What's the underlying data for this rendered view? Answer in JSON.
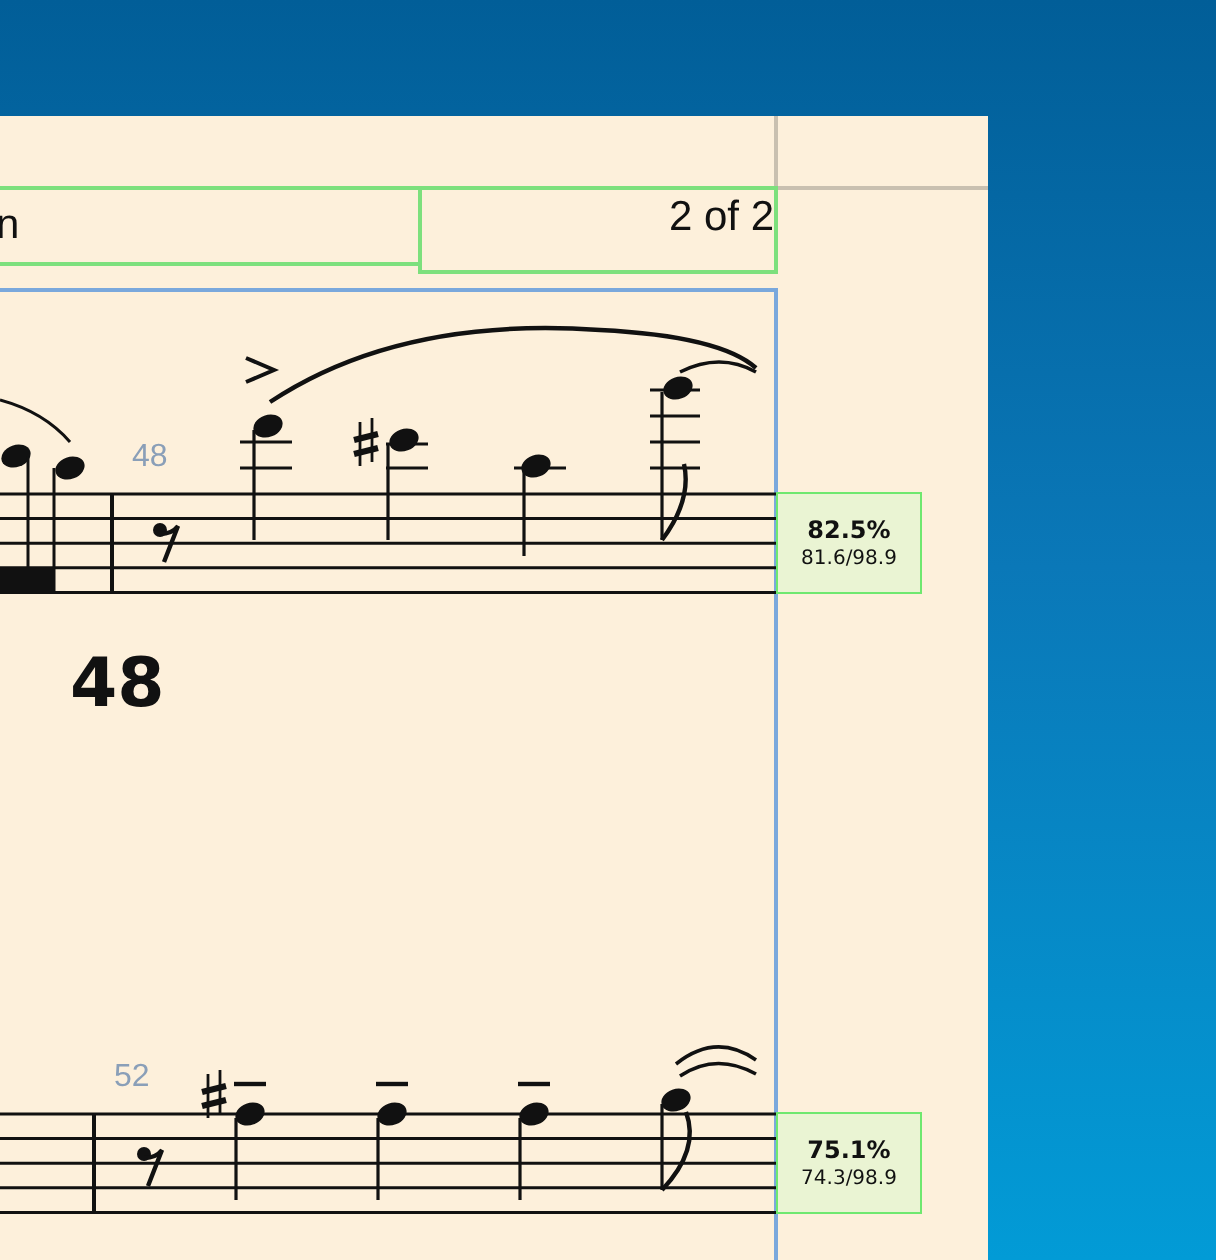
{
  "header": {
    "title_fragment": "n",
    "page_indicator": "2 of 2"
  },
  "systems": [
    {
      "measure_number": "48",
      "fit": {
        "percent": "82.5%",
        "ratio": "81.6/98.9"
      }
    },
    {
      "measure_number": "52",
      "fit": {
        "percent": "75.1%",
        "ratio": "74.3/98.9"
      }
    }
  ],
  "rehearsal_mark": "48"
}
